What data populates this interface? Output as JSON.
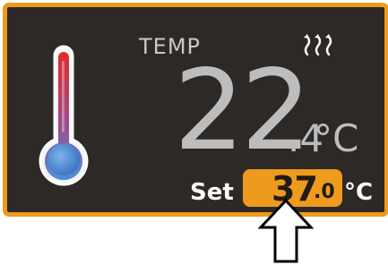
{
  "display": {
    "label": "TEMP",
    "current_integer": "22",
    "current_decimal": ".4",
    "current_unit": "°C",
    "heating_icon": "heat-waves-icon",
    "thermometer_icon": "thermometer-icon"
  },
  "setpoint": {
    "label": "Set",
    "integer": "37",
    "decimal": ".0",
    "unit": "°C"
  },
  "annotation": {
    "arrow_icon": "up-arrow-icon"
  },
  "colors": {
    "panel_background": "#2c2927",
    "accent_orange": "#ee9a1c",
    "reading_gray": "#bdbdbd",
    "thermometer_red": "#e02a2a",
    "thermometer_blue": "#4e8fd6"
  }
}
